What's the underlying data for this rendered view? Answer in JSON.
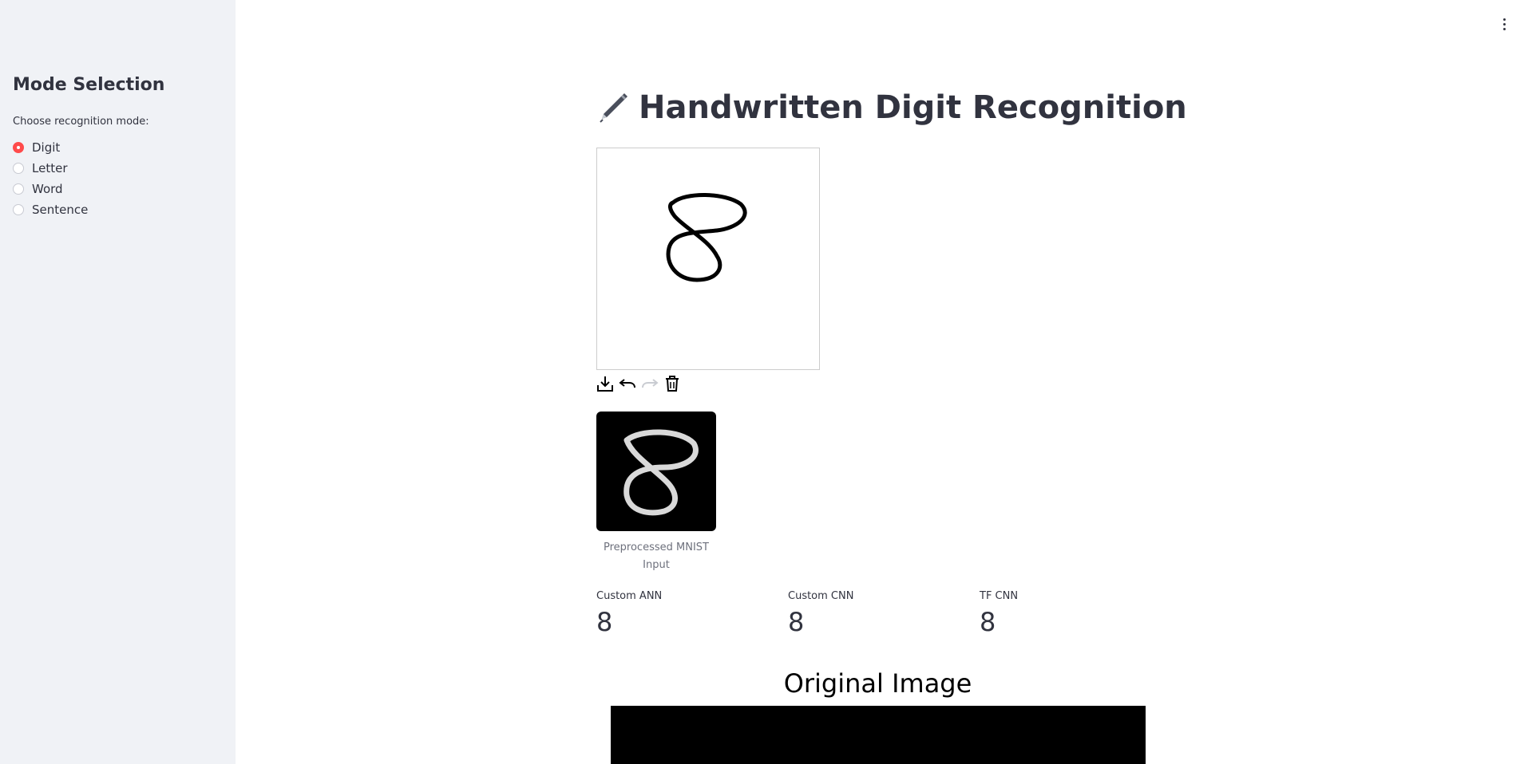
{
  "sidebar": {
    "heading": "Mode Selection",
    "radio_label": "Choose recognition mode:",
    "options": [
      {
        "label": "Digit",
        "selected": true
      },
      {
        "label": "Letter",
        "selected": false
      },
      {
        "label": "Word",
        "selected": false
      },
      {
        "label": "Sentence",
        "selected": false
      }
    ],
    "accent_color": "#ff4b4b"
  },
  "main": {
    "title_icon": "pen-icon",
    "title": "Handwritten Digit Recognition",
    "canvas": {
      "drawn_digit": "8"
    },
    "toolbar": [
      "download-icon",
      "undo-icon",
      "redo-icon",
      "trash-icon"
    ],
    "preprocessed_caption": "Preprocessed MNIST Input",
    "metrics": [
      {
        "label": "Custom ANN",
        "value": "8"
      },
      {
        "label": "Custom CNN",
        "value": "8"
      },
      {
        "label": "TF CNN",
        "value": "8"
      }
    ],
    "original_image_title": "Original Image"
  },
  "menu": {
    "icon": "kebab-menu-icon"
  }
}
